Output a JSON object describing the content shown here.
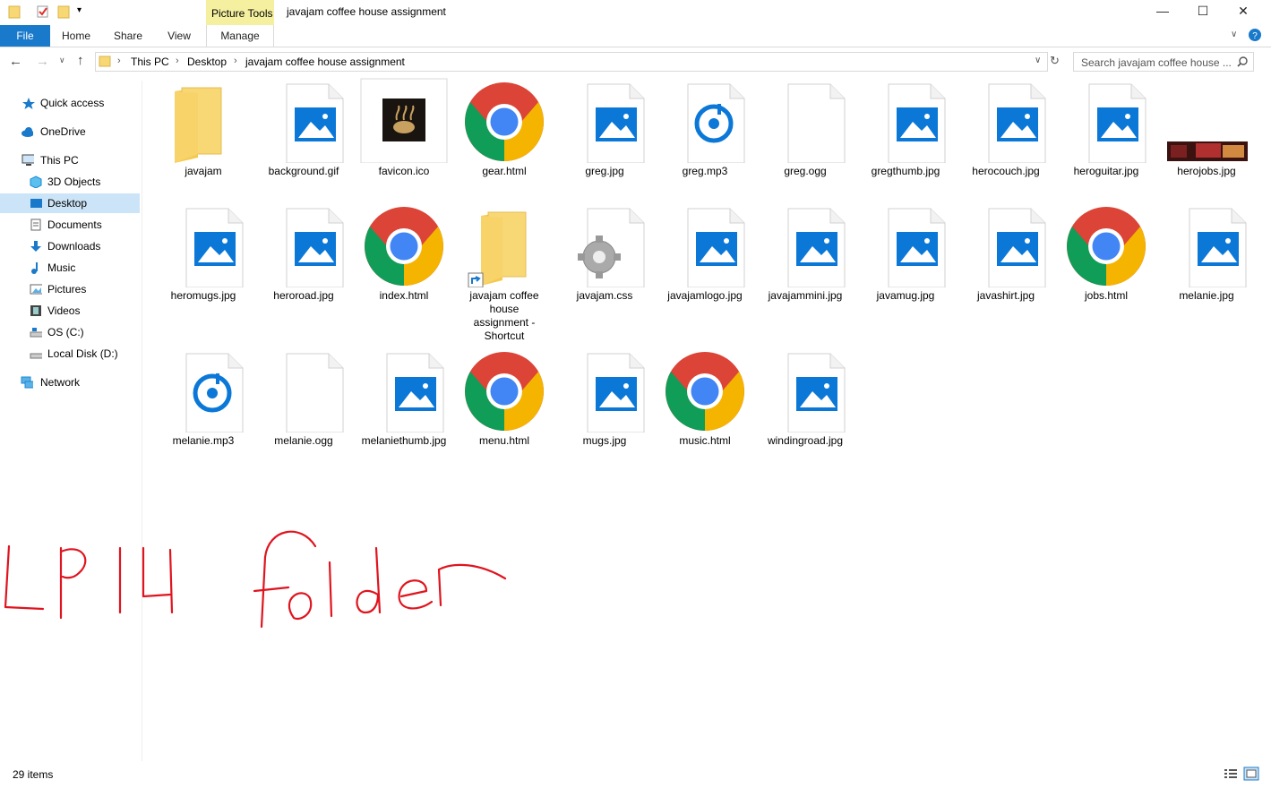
{
  "titlebar": {
    "title": "javajam coffee house assignment",
    "context_tab": "Picture Tools",
    "minimize": "—",
    "maximize": "☐",
    "close": "✕"
  },
  "ribbon": {
    "tabs": [
      "File",
      "Home",
      "Share",
      "View",
      "Manage"
    ]
  },
  "address": {
    "crumbs": [
      "This PC",
      "Desktop",
      "javajam coffee house assignment"
    ],
    "search_placeholder": "Search javajam coffee house ..."
  },
  "nav": {
    "items": [
      {
        "label": "Quick access",
        "icon": "star-icon"
      },
      {
        "label": "OneDrive",
        "icon": "cloud-icon"
      },
      {
        "label": "This PC",
        "icon": "computer-icon"
      },
      {
        "label": "3D Objects",
        "icon": "cube-icon"
      },
      {
        "label": "Desktop",
        "icon": "desktop-icon"
      },
      {
        "label": "Documents",
        "icon": "document-icon"
      },
      {
        "label": "Downloads",
        "icon": "download-icon"
      },
      {
        "label": "Music",
        "icon": "music-icon"
      },
      {
        "label": "Pictures",
        "icon": "pictures-icon"
      },
      {
        "label": "Videos",
        "icon": "film-icon"
      },
      {
        "label": "OS (C:)",
        "icon": "drive-icon"
      },
      {
        "label": "Local Disk (D:)",
        "icon": "drive-icon"
      },
      {
        "label": "Network",
        "icon": "network-icon"
      }
    ],
    "selected": "Desktop"
  },
  "files": [
    {
      "name": "javajam",
      "type": "folder"
    },
    {
      "name": "background.gif",
      "type": "image"
    },
    {
      "name": "favicon.ico",
      "type": "favicon"
    },
    {
      "name": "gear.html",
      "type": "chrome"
    },
    {
      "name": "greg.jpg",
      "type": "image"
    },
    {
      "name": "greg.mp3",
      "type": "audio"
    },
    {
      "name": "greg.ogg",
      "type": "blank"
    },
    {
      "name": "gregthumb.jpg",
      "type": "image"
    },
    {
      "name": "herocouch.jpg",
      "type": "image"
    },
    {
      "name": "heroguitar.jpg",
      "type": "image"
    },
    {
      "name": "herojobs.jpg",
      "type": "photo"
    },
    {
      "name": "heromugs.jpg",
      "type": "image"
    },
    {
      "name": "heroroad.jpg",
      "type": "image"
    },
    {
      "name": "index.html",
      "type": "chrome"
    },
    {
      "name": "javajam coffee house assignment - Shortcut",
      "type": "shortcut"
    },
    {
      "name": "javajam.css",
      "type": "css"
    },
    {
      "name": "javajamlogo.jpg",
      "type": "image"
    },
    {
      "name": "javajammini.jpg",
      "type": "image"
    },
    {
      "name": "javamug.jpg",
      "type": "image"
    },
    {
      "name": "javashirt.jpg",
      "type": "image"
    },
    {
      "name": "jobs.html",
      "type": "chrome"
    },
    {
      "name": "melanie.jpg",
      "type": "image"
    },
    {
      "name": "melanie.mp3",
      "type": "audio"
    },
    {
      "name": "melanie.ogg",
      "type": "blank"
    },
    {
      "name": "melaniethumb.jpg",
      "type": "image"
    },
    {
      "name": "menu.html",
      "type": "chrome"
    },
    {
      "name": "mugs.jpg",
      "type": "image"
    },
    {
      "name": "music.html",
      "type": "chrome"
    },
    {
      "name": "windingroad.jpg",
      "type": "image"
    }
  ],
  "status": {
    "count": "29 items"
  },
  "annotation": {
    "text": "LP14 folder",
    "color": "#e0141e"
  },
  "colors": {
    "accent": "#1979ca",
    "image_blue": "#0b78d7",
    "folder": "#f8d775"
  }
}
